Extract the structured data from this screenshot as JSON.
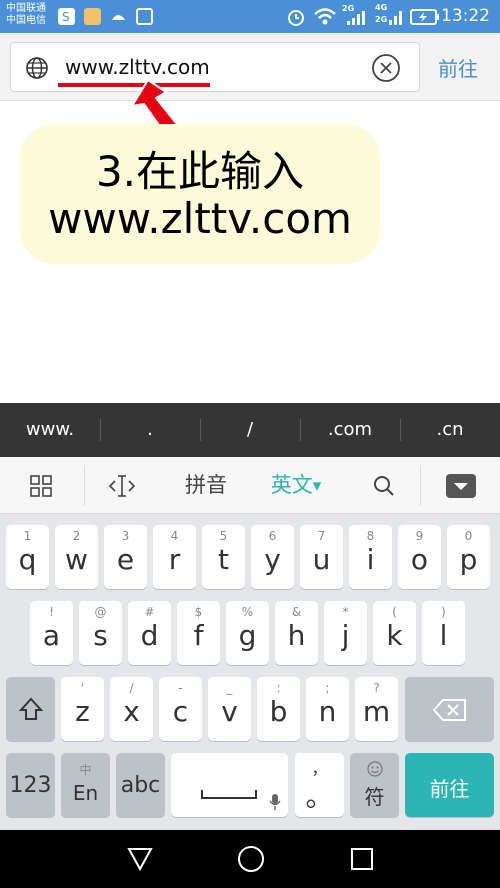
{
  "status_bar": {
    "carrier_1": "中国联通",
    "carrier_2": "中国电信",
    "net_1": "2G",
    "net_2": "4G",
    "net_3": "2G",
    "time": "13:22"
  },
  "address_bar": {
    "url": "www.zlttv.com",
    "go_label": "前往"
  },
  "annotation": {
    "line1": "3.在此输入",
    "line2": "www.zlttv.com"
  },
  "suggestions": [
    "www.",
    ".",
    "/",
    ".com",
    ".cn"
  ],
  "toolbar": {
    "pinyin": "拼音",
    "english": "英文"
  },
  "keyboard": {
    "row1": [
      {
        "sub": "1",
        "key": "q"
      },
      {
        "sub": "2",
        "key": "w"
      },
      {
        "sub": "3",
        "key": "e"
      },
      {
        "sub": "4",
        "key": "r"
      },
      {
        "sub": "5",
        "key": "t"
      },
      {
        "sub": "6",
        "key": "y"
      },
      {
        "sub": "7",
        "key": "u"
      },
      {
        "sub": "8",
        "key": "i"
      },
      {
        "sub": "9",
        "key": "o"
      },
      {
        "sub": "0",
        "key": "p"
      }
    ],
    "row2": [
      {
        "sub": "!",
        "key": "a"
      },
      {
        "sub": "@",
        "key": "s"
      },
      {
        "sub": "#",
        "key": "d"
      },
      {
        "sub": "$",
        "key": "f"
      },
      {
        "sub": "%",
        "key": "g"
      },
      {
        "sub": "&",
        "key": "h"
      },
      {
        "sub": "*",
        "key": "j"
      },
      {
        "sub": "(",
        "key": "k"
      },
      {
        "sub": ")",
        "key": "l"
      }
    ],
    "row3": [
      {
        "sub": "'",
        "key": "z"
      },
      {
        "sub": "/",
        "key": "x"
      },
      {
        "sub": "-",
        "key": "c"
      },
      {
        "sub": "_",
        "key": "v"
      },
      {
        "sub": ":",
        "key": "b"
      },
      {
        "sub": ";",
        "key": "n"
      },
      {
        "sub": "?",
        "key": "m"
      }
    ],
    "num_label": "123",
    "cn_sub": "中",
    "cn_main": "En",
    "abc_label": "abc",
    "comma_sub": "，",
    "period_main": "。",
    "emoji_main": "符",
    "enter_label": "前往"
  },
  "colors": {
    "status_bar": "#4a90d9",
    "accent": "#2cb5b5",
    "link": "#4a8fd4",
    "annotation_red": "#e60012"
  }
}
